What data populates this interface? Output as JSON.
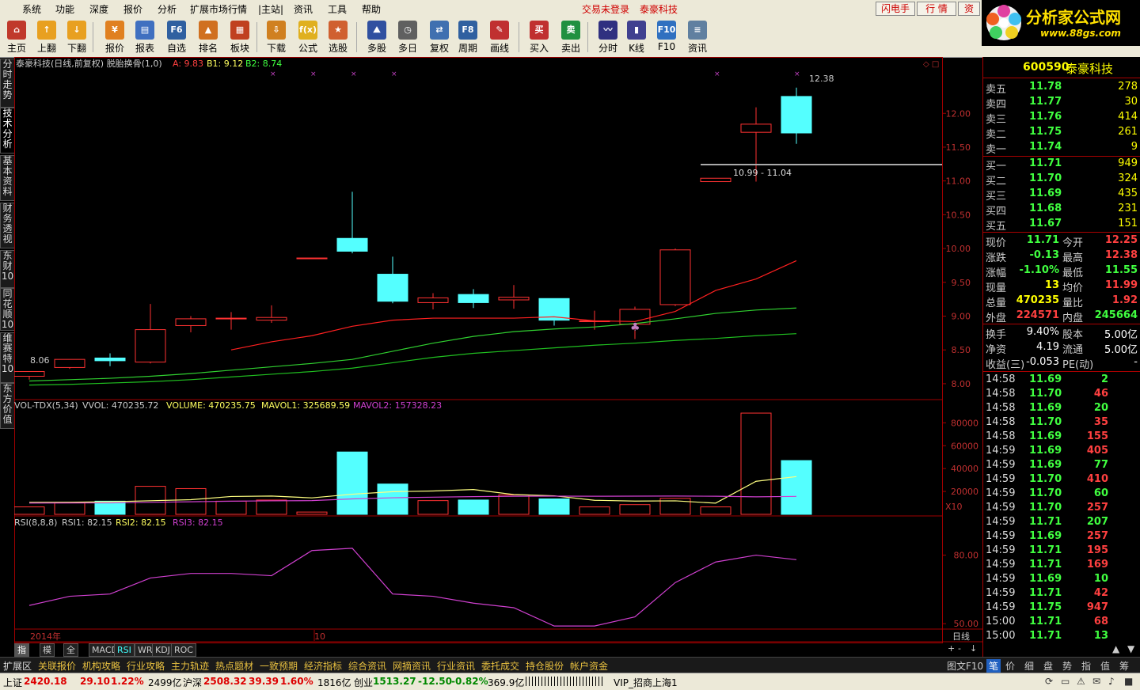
{
  "menu": {
    "items": [
      "系统",
      "功能",
      "深度",
      "报价",
      "分析",
      "扩展市场行情",
      "|主站|",
      "资讯",
      "工具",
      "帮助"
    ],
    "status_login": "交易未登录",
    "status_stock": "泰豪科技",
    "btn_flash": "闪电手",
    "btn_quote": "行 情",
    "btn_zi": "资"
  },
  "toolbar": [
    {
      "label": "主页",
      "icon": "home-icon"
    },
    {
      "label": "上翻",
      "icon": "arrow-up-icon"
    },
    {
      "label": "下翻",
      "icon": "arrow-down-icon"
    },
    {
      "label": "报价",
      "icon": "yen-icon"
    },
    {
      "label": "报表",
      "icon": "report-icon"
    },
    {
      "label": "自选",
      "icon": "f6-icon"
    },
    {
      "label": "排名",
      "icon": "rank-icon"
    },
    {
      "label": "板块",
      "icon": "blocks-icon"
    },
    {
      "label": "下载",
      "icon": "download-icon"
    },
    {
      "label": "公式",
      "icon": "formula-icon"
    },
    {
      "label": "选股",
      "icon": "stock-pick-icon"
    },
    {
      "label": "多股",
      "icon": "multi-stock-icon"
    },
    {
      "label": "多日",
      "icon": "clock-icon"
    },
    {
      "label": "复权",
      "icon": "restore-icon"
    },
    {
      "label": "周期",
      "icon": "f8-icon"
    },
    {
      "label": "画线",
      "icon": "draw-line-icon"
    },
    {
      "label": "买入",
      "icon": "buy-icon"
    },
    {
      "label": "卖出",
      "icon": "sell-icon"
    },
    {
      "label": "分时",
      "icon": "intraday-icon"
    },
    {
      "label": "K线",
      "icon": "kline-icon"
    },
    {
      "label": "F10",
      "icon": "f10-icon"
    },
    {
      "label": "资讯",
      "icon": "news-icon"
    }
  ],
  "logo": {
    "title": "分析家公式网",
    "url": "www.88gs.com"
  },
  "left_tabs": [
    "分时走势",
    "技术分析",
    "基本资料",
    "财务透视",
    "东财10",
    "同花顺10",
    "维赛特10",
    "东方价值"
  ],
  "chart_header": {
    "main": "泰豪科技(日线,前复权) 脱胎换骨(1,0)",
    "a": "A: 9.83",
    "b1": "B1: 9.12",
    "b2": "B2: 8.74"
  },
  "chart_annotations": {
    "high": "12.38",
    "low": "8.06",
    "range": "10.99 - 11.04"
  },
  "vol_header": {
    "name": "VOL-TDX(5,34)",
    "vvol": "VVOL: 470235.72",
    "volume": "VOLUME: 470235.75",
    "mavol1": "MAVOL1: 325689.59",
    "mavol2": "MAVOL2: 157328.23",
    "multiplier": "X10"
  },
  "rsi_header": {
    "name": "RSI(8,8,8)",
    "rsi1": "RSI1: 82.15",
    "rsi2": "RSI2: 82.15",
    "rsi3": "RSI3: 82.15"
  },
  "x_axis": {
    "year": "2014年",
    "month": "10",
    "mode": "日线"
  },
  "colors": {
    "up": "#ff3232",
    "down": "#54ffff",
    "ma1": "#ff2020",
    "ma2": "#30d030",
    "ma3": "#20c020",
    "rsi": "#d040d0",
    "mavol1": "#ffff80",
    "mavol2": "#d040d0"
  },
  "chart_data": [
    {
      "type": "candlestick",
      "ylim": [
        7.8,
        12.6
      ],
      "yticks": [
        "12.00",
        "11.50",
        "11.00",
        "10.50",
        "10.00",
        "9.50",
        "9.00",
        "8.50",
        "8.00"
      ],
      "candles": [
        {
          "o": 8.11,
          "h": 8.18,
          "l": 8.06,
          "c": 8.18
        },
        {
          "o": 8.24,
          "h": 8.35,
          "l": 8.22,
          "c": 8.36
        },
        {
          "o": 8.38,
          "h": 8.45,
          "l": 8.26,
          "c": 8.34
        },
        {
          "o": 8.32,
          "h": 9.18,
          "l": 8.3,
          "c": 8.8
        },
        {
          "o": 8.86,
          "h": 9.0,
          "l": 8.76,
          "c": 8.96
        },
        {
          "o": 8.97,
          "h": 9.06,
          "l": 8.8,
          "c": 8.97
        },
        {
          "o": 8.94,
          "h": 9.16,
          "l": 8.9,
          "c": 8.98
        },
        {
          "o": 9.86,
          "h": 9.86,
          "l": 9.86,
          "c": 9.86
        },
        {
          "o": 10.15,
          "h": 10.84,
          "l": 9.93,
          "c": 9.96
        },
        {
          "o": 9.62,
          "h": 9.88,
          "l": 9.19,
          "c": 9.22
        },
        {
          "o": 9.2,
          "h": 9.34,
          "l": 9.1,
          "c": 9.27
        },
        {
          "o": 9.32,
          "h": 9.4,
          "l": 9.12,
          "c": 9.2
        },
        {
          "o": 9.24,
          "h": 9.46,
          "l": 9.11,
          "c": 9.28
        },
        {
          "o": 9.26,
          "h": 9.26,
          "l": 8.86,
          "c": 8.94
        },
        {
          "o": 8.93,
          "h": 9.08,
          "l": 8.8,
          "c": 8.93
        },
        {
          "o": 8.88,
          "h": 9.14,
          "l": 8.66,
          "c": 9.1
        },
        {
          "o": 9.17,
          "h": 10.0,
          "l": 9.15,
          "c": 9.98
        },
        {
          "o": 10.99,
          "h": 11.04,
          "l": 10.99,
          "c": 11.04
        },
        {
          "o": 11.72,
          "h": 12.09,
          "l": 10.99,
          "c": 11.84
        },
        {
          "o": 12.25,
          "h": 12.38,
          "l": 11.55,
          "c": 11.71
        }
      ],
      "ma1": [
        null,
        null,
        null,
        null,
        null,
        8.5,
        8.62,
        8.71,
        8.85,
        8.94,
        8.97,
        8.97,
        8.97,
        8.99,
        8.93,
        8.92,
        9.07,
        9.38,
        9.55,
        9.82
      ],
      "ma2": [
        8.04,
        8.06,
        8.08,
        8.11,
        8.15,
        8.2,
        8.25,
        8.3,
        8.36,
        8.48,
        8.6,
        8.7,
        8.77,
        8.81,
        8.84,
        8.89,
        8.96,
        9.04,
        9.09,
        9.12
      ],
      "ma3": [
        7.98,
        7.99,
        8.01,
        8.03,
        8.06,
        8.1,
        8.14,
        8.18,
        8.23,
        8.31,
        8.39,
        8.45,
        8.49,
        8.53,
        8.57,
        8.6,
        8.64,
        8.67,
        8.71,
        8.74
      ]
    },
    {
      "type": "bar",
      "name": "VOL",
      "ylim": [
        0,
        92000
      ],
      "yticks": [
        "80000",
        "60000",
        "40000",
        "20000"
      ],
      "values": [
        6500,
        10000,
        11500,
        24500,
        22500,
        11500,
        12500,
        2000,
        54500,
        26500,
        12000,
        12500,
        17000,
        13500,
        6500,
        8500,
        14000,
        6500,
        88500,
        47000
      ],
      "mavol1": [
        10500,
        10600,
        11000,
        11900,
        12800,
        15600,
        16000,
        14400,
        17600,
        19800,
        20400,
        21700,
        17300,
        16200,
        12300,
        11600,
        11800,
        9800,
        28900,
        33000
      ],
      "mavol2": [
        9800,
        9900,
        10000,
        10500,
        11000,
        11500,
        11800,
        12000,
        13500,
        14500,
        15000,
        15500,
        15800,
        15900,
        15800,
        15900,
        16000,
        15800,
        15300,
        15700
      ]
    },
    {
      "type": "line",
      "name": "RSI",
      "ylim": [
        48,
        93
      ],
      "yticks": [
        "80.00",
        "50.00"
      ],
      "values": [
        58,
        62,
        63,
        70,
        72,
        72,
        71,
        82,
        83,
        63,
        62,
        59,
        57,
        49,
        49,
        53,
        68,
        77,
        80,
        78
      ]
    }
  ],
  "stock": {
    "code": "600590",
    "name": "泰豪科技"
  },
  "order_book": {
    "sells": [
      {
        "label": "卖五",
        "price": "11.78",
        "vol": "278"
      },
      {
        "label": "卖四",
        "price": "11.77",
        "vol": "30"
      },
      {
        "label": "卖三",
        "price": "11.76",
        "vol": "414"
      },
      {
        "label": "卖二",
        "price": "11.75",
        "vol": "261"
      },
      {
        "label": "卖一",
        "price": "11.74",
        "vol": "9"
      }
    ],
    "buys": [
      {
        "label": "买一",
        "price": "11.71",
        "vol": "949"
      },
      {
        "label": "买二",
        "price": "11.70",
        "vol": "324"
      },
      {
        "label": "买三",
        "price": "11.69",
        "vol": "435"
      },
      {
        "label": "买四",
        "price": "11.68",
        "vol": "231"
      },
      {
        "label": "买五",
        "price": "11.67",
        "vol": "151"
      }
    ]
  },
  "quote_stats": [
    {
      "l1": "现价",
      "v1": "11.71",
      "l2": "今开",
      "v2": "12.25"
    },
    {
      "l1": "涨跌",
      "v1": "-0.13",
      "l2": "最高",
      "v2": "12.38"
    },
    {
      "l1": "涨幅",
      "v1": "-1.10%",
      "l2": "最低",
      "v2": "11.55"
    },
    {
      "l1": "现量",
      "v1": "13",
      "l2": "均价",
      "v2": "11.99"
    },
    {
      "l1": "总量",
      "v1": "470235",
      "l2": "量比",
      "v2": "1.92"
    },
    {
      "l1": "外盘",
      "v1": "224571",
      "l2": "内盘",
      "v2": "245664"
    }
  ],
  "fundamentals": [
    {
      "l1": "换手",
      "v1": "9.40%",
      "l2": "股本",
      "v2": "5.00亿"
    },
    {
      "l1": "净资",
      "v1": "4.19",
      "l2": "流通",
      "v2": "5.00亿"
    },
    {
      "l1": "收益(三)",
      "v1": "-0.053",
      "l2": "PE(动)",
      "v2": "-"
    }
  ],
  "ticks": [
    {
      "t": "14:58",
      "p": "11.69",
      "v": "2"
    },
    {
      "t": "14:58",
      "p": "11.70",
      "v": "46"
    },
    {
      "t": "14:58",
      "p": "11.69",
      "v": "20"
    },
    {
      "t": "14:58",
      "p": "11.70",
      "v": "35"
    },
    {
      "t": "14:58",
      "p": "11.69",
      "v": "155"
    },
    {
      "t": "14:59",
      "p": "11.69",
      "v": "405"
    },
    {
      "t": "14:59",
      "p": "11.69",
      "v": "77"
    },
    {
      "t": "14:59",
      "p": "11.70",
      "v": "410"
    },
    {
      "t": "14:59",
      "p": "11.70",
      "v": "60"
    },
    {
      "t": "14:59",
      "p": "11.70",
      "v": "257"
    },
    {
      "t": "14:59",
      "p": "11.71",
      "v": "207"
    },
    {
      "t": "14:59",
      "p": "11.69",
      "v": "257"
    },
    {
      "t": "14:59",
      "p": "11.71",
      "v": "195"
    },
    {
      "t": "14:59",
      "p": "11.71",
      "v": "169"
    },
    {
      "t": "14:59",
      "p": "11.69",
      "v": "10"
    },
    {
      "t": "14:59",
      "p": "11.71",
      "v": "42"
    },
    {
      "t": "14:59",
      "p": "11.75",
      "v": "947"
    },
    {
      "t": "15:00",
      "p": "11.71",
      "v": "68"
    },
    {
      "t": "15:00",
      "p": "11.71",
      "v": "13"
    }
  ],
  "indicator_tabs": [
    "指标",
    "模板",
    "全部",
    "MACD",
    "RSI",
    "WR",
    "KDJ",
    "ROC"
  ],
  "info_tabs": [
    "扩展区",
    "关联报价",
    "机构攻略",
    "行业攻略",
    "主力轨迹",
    "热点题材",
    "一致预期",
    "经济指标",
    "综合资讯",
    "网摘资讯",
    "行业资讯",
    "委托成交",
    "持仓股份",
    "帐户资金"
  ],
  "info_right": {
    "label": "图文F10"
  },
  "right_tabs": [
    "笔",
    "价",
    "细",
    "盘",
    "势",
    "指",
    "值",
    "筹"
  ],
  "status": {
    "sh_label": "上证",
    "sh_val": "2420.18",
    "sh_chg": "29.10",
    "sh_pct": "1.22%",
    "sh_amt": "2499亿",
    "sz_label": "沪深",
    "sz_val": "2508.32",
    "sz_chg": "39.39",
    "sz_pct": "1.60%",
    "sz_amt": "1816亿",
    "cy_label": "创业",
    "cy_val": "1513.27",
    "cy_chg": "-12.50",
    "cy_pct": "-0.82%",
    "cy_amt": "369.9亿",
    "server": "VIP_招商上海1"
  }
}
